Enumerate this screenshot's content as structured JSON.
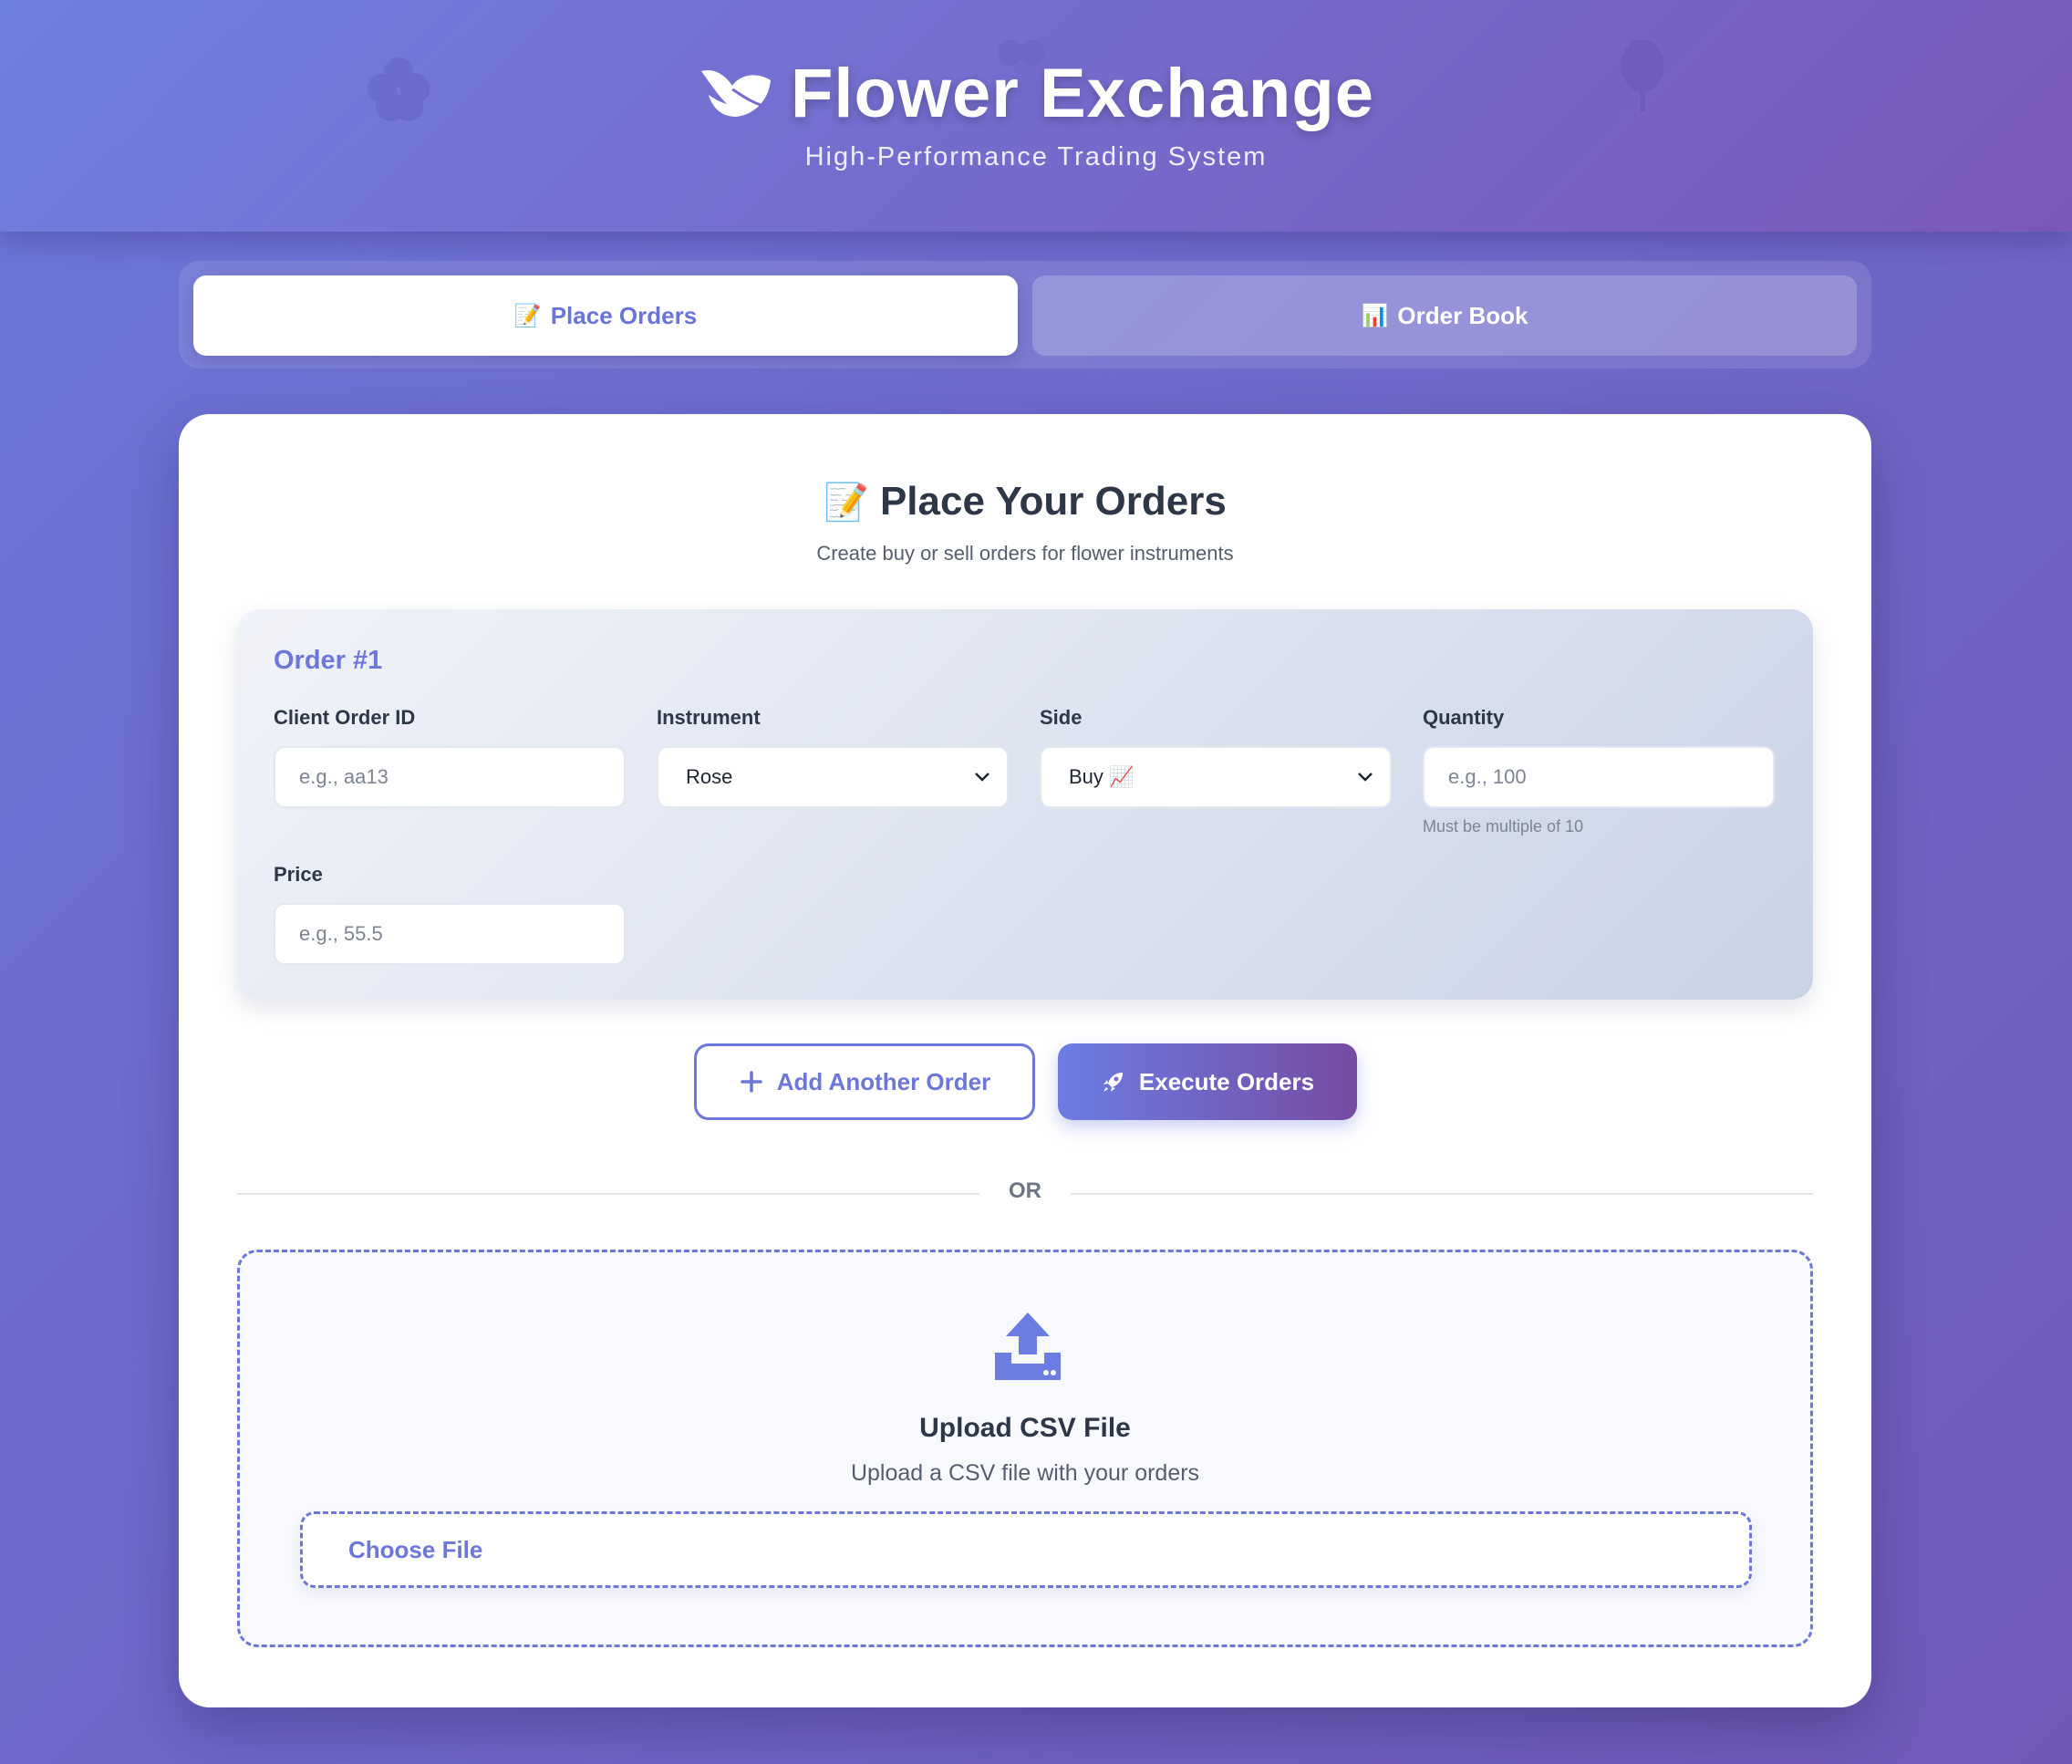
{
  "header": {
    "title": "Flower Exchange",
    "subtitle": "High-Performance Trading System",
    "logo_icon": "leaf-icon"
  },
  "tabs": [
    {
      "emoji": "📝",
      "label": "Place Orders",
      "active": true
    },
    {
      "emoji": "📊",
      "label": "Order Book",
      "active": false
    }
  ],
  "card": {
    "title_emoji": "📝",
    "title": "Place Your Orders",
    "subtitle": "Create buy or sell orders for flower instruments"
  },
  "order": {
    "label": "Order #1",
    "fields": {
      "client_order_id": {
        "label": "Client Order ID",
        "placeholder": "e.g., aa13"
      },
      "instrument": {
        "label": "Instrument",
        "value": "Rose"
      },
      "side": {
        "label": "Side",
        "value": "Buy 📈"
      },
      "quantity": {
        "label": "Quantity",
        "placeholder": "e.g., 100",
        "hint": "Must be multiple of 10"
      },
      "price": {
        "label": "Price",
        "placeholder": "e.g., 55.5"
      }
    }
  },
  "actions": {
    "add_label": "Add Another Order",
    "execute_label": "Execute Orders"
  },
  "divider": {
    "text": "OR"
  },
  "upload": {
    "title": "Upload CSV File",
    "subtitle": "Upload a CSV file with your orders",
    "button_label": "Choose File"
  },
  "colors": {
    "accent": "#6b77d9",
    "accent_dark": "#764ba2",
    "text": "#2d3748"
  }
}
